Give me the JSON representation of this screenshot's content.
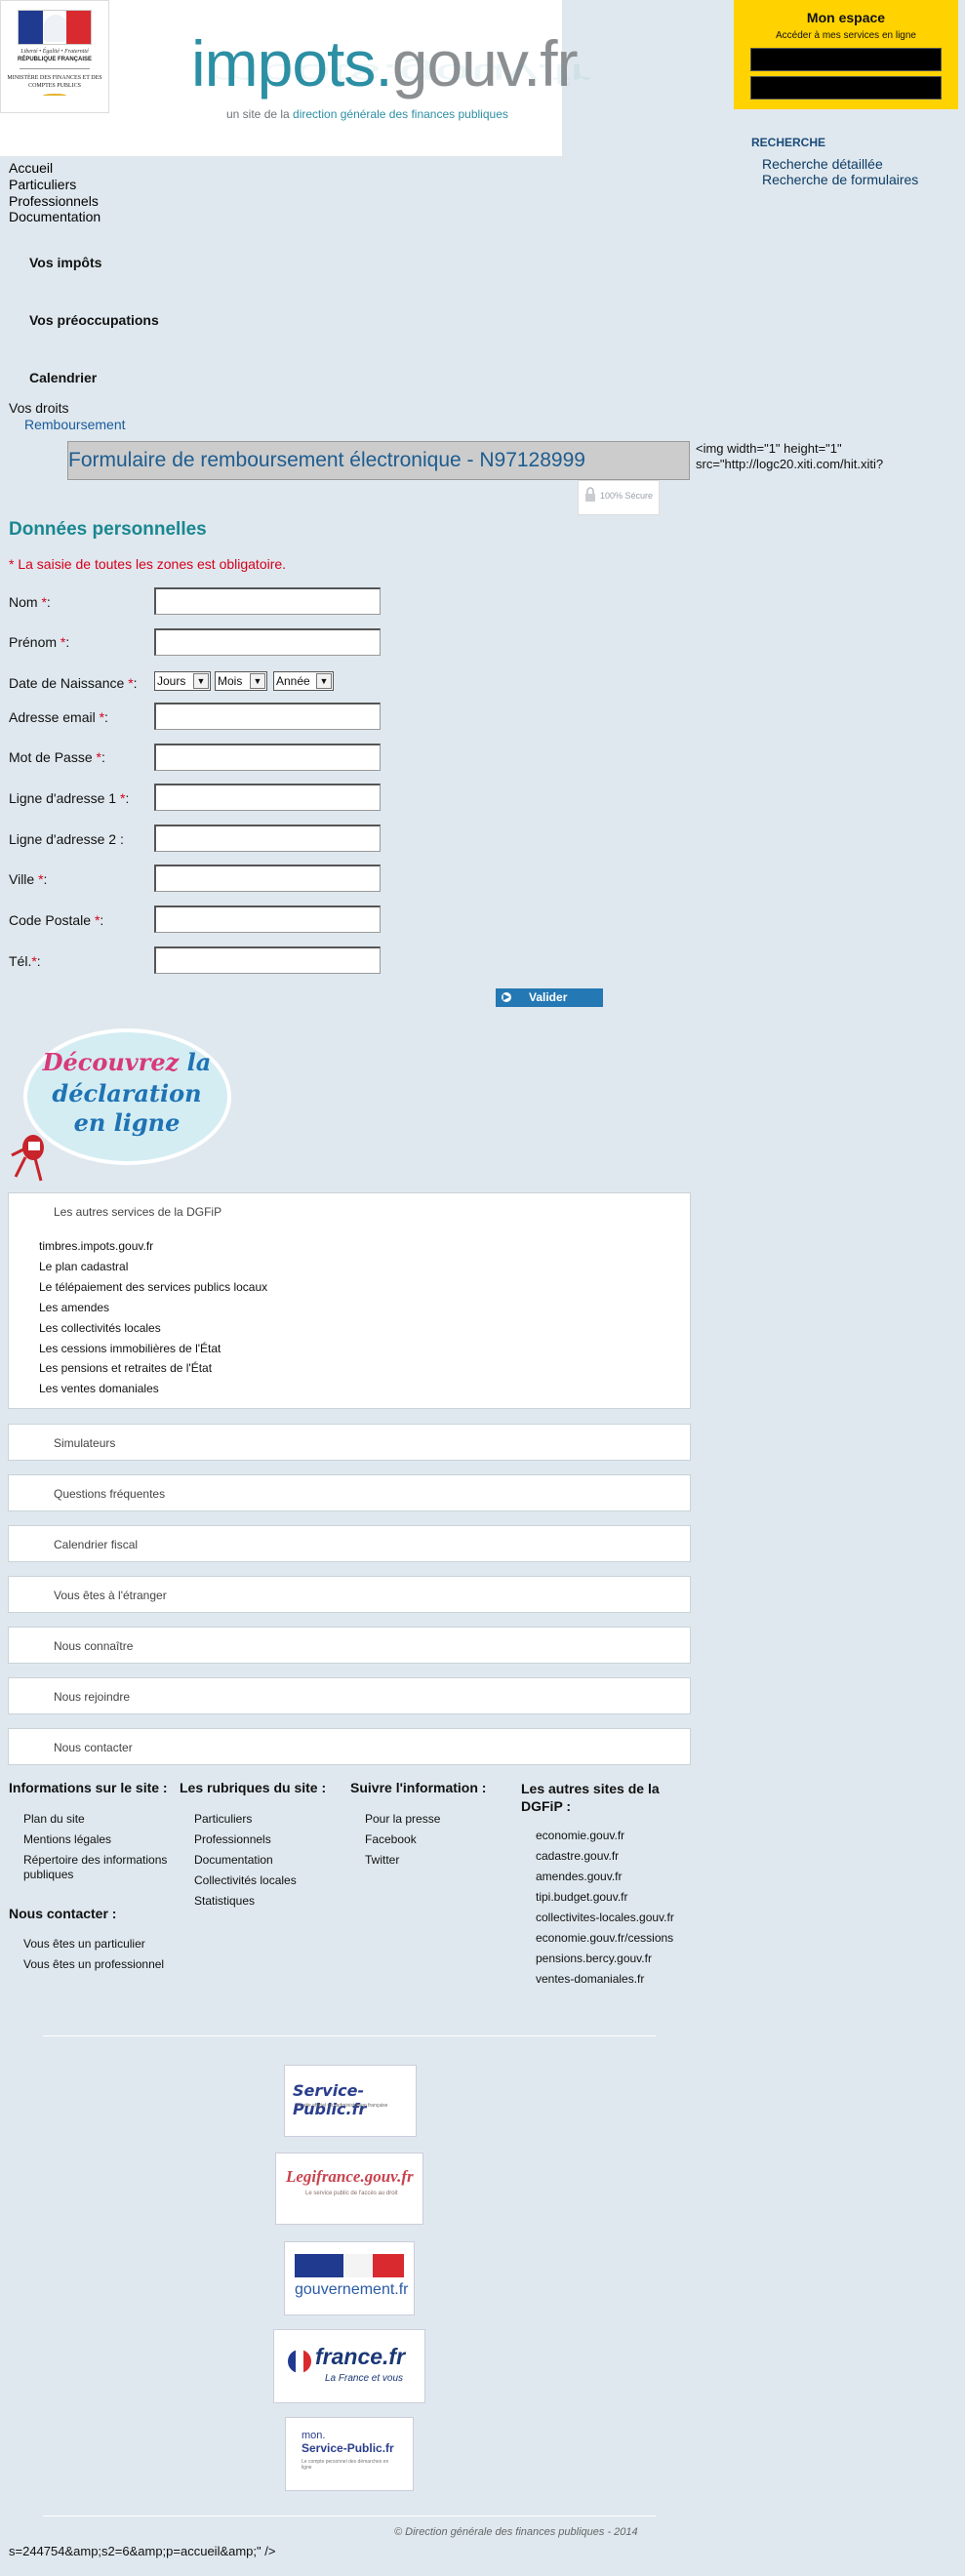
{
  "header": {
    "site_name_a": "impots.",
    "site_name_b": "gouv.fr",
    "tagline_a": "un site de la ",
    "tagline_b": "direction générale des finances publiques",
    "marianne": {
      "motto": "Liberté • Égalité • Fraternité",
      "republic": "RÉPUBLIQUE FRANÇAISE",
      "ministry": "MINISTÈRE DES FINANCES ET DES COMPTES PUBLICS"
    }
  },
  "mon_espace": {
    "title": "Mon espace",
    "subtitle": "Accéder à mes services en ligne",
    "field1_value": "",
    "field2_value": ""
  },
  "recherche": {
    "title": "RECHERCHE",
    "links": [
      "Recherche détaillée",
      "Recherche de formulaires"
    ]
  },
  "nav": [
    "Accueil",
    "Particuliers",
    "Professionnels",
    "Documentation"
  ],
  "sections": [
    "Vos impôts",
    "Vos préoccupations",
    "Calendrier"
  ],
  "breadcrumb": {
    "parent": "Vos droits",
    "current": "Remboursement"
  },
  "form_title": "Formulaire de remboursement électronique - N97128999",
  "stray_img_text": "<img width=\"1\" height=\"1\" src=\"http://logc20.xiti.com/hit.xiti?",
  "secure_badge": "100% Sécure",
  "section_title": "Données personnelles",
  "required_note": "* La saisie de toutes les zones est obligatoire.",
  "form": {
    "nom": {
      "label": "Nom ",
      "star": "*",
      "after": ":"
    },
    "prenom": {
      "label": "Prénom ",
      "star": "*",
      "after": ":"
    },
    "dob": {
      "label": "Date de Naissance ",
      "star": "*",
      "after": ":",
      "jours": "Jours",
      "mois": "Mois",
      "annee": "Année"
    },
    "email": {
      "label": "Adresse email ",
      "star": "*",
      "after": ":"
    },
    "password": {
      "label": "Mot de Passe ",
      "star": "*",
      "after": ":"
    },
    "addr1": {
      "label": "Ligne d'adresse 1 ",
      "star": "*",
      "after": ":"
    },
    "addr2": {
      "label": "Ligne d'adresse 2 :"
    },
    "ville": {
      "label": "Ville ",
      "star": "*",
      "after": ":"
    },
    "cp": {
      "label": "Code Postale ",
      "star": "*",
      "after": ":"
    },
    "tel": {
      "label": "Tél.",
      "star": "*",
      "after": ":"
    },
    "submit": "Valider"
  },
  "promo": {
    "line1a": "Découvrez ",
    "line1b": "la",
    "line2": "déclaration",
    "line3": "en ligne"
  },
  "accordion": {
    "other_services": {
      "title": "Les autres services de la DGFiP",
      "items": [
        "timbres.impots.gouv.fr",
        "Le plan cadastral",
        "Le télépaiement des services publics locaux",
        "Les amendes",
        "Les collectivités locales",
        "Les cessions immobilières de l'État",
        "Les pensions et retraites de l'État",
        "Les ventes domaniales"
      ]
    },
    "panels": [
      "Simulateurs",
      "Questions fréquentes",
      "Calendrier fiscal",
      "Vous êtes à l'étranger",
      "Nous connaître",
      "Nous rejoindre",
      "Nous contacter"
    ]
  },
  "footer": {
    "info_title": "Informations sur le site :",
    "info_links": [
      "Plan du site",
      "Mentions légales",
      "Répertoire des informations publiques"
    ],
    "rubriques_title": "Les rubriques du site :",
    "rubriques_links": [
      "Particuliers",
      "Professionnels",
      "Documentation",
      "Collectivités locales",
      "Statistiques"
    ],
    "suivre_title": "Suivre l'information :",
    "suivre_links": [
      "Pour la presse",
      "Facebook",
      "Twitter"
    ],
    "autres_title": "Les autres sites de la DGFiP :",
    "autres_links": [
      "economie.gouv.fr",
      "cadastre.gouv.fr",
      "amendes.gouv.fr",
      "tipi.budget.gouv.fr",
      "collectivites-locales.gouv.fr",
      "economie.gouv.fr/cessions",
      "pensions.bercy.gouv.fr",
      "ventes-domaniales.fr"
    ],
    "contact_title": "Nous contacter :",
    "contact_links": [
      "Vous êtes un particulier",
      "Vous êtes un professionnel"
    ],
    "partners": {
      "service_public": "Service-Public.fr",
      "service_public_sub": "Le site officiel de l'administration française",
      "legifrance": "Legifrance.gouv.fr",
      "legifrance_sub": "Le service public de l'accès au droit",
      "gouvernement": "gouvernement.fr",
      "france": "france.fr",
      "france_sub": "La France et vous",
      "mon_sp_a": "mon.",
      "mon_sp_b": "Service-Public.fr",
      "mon_sp_sub": "Le compte personnel des démarches en ligne"
    },
    "copyright": "© Direction générale des finances publiques - 2014"
  },
  "raw_tail": "s=244754&amp;s2=6&amp;p=accueil&amp;\" />"
}
